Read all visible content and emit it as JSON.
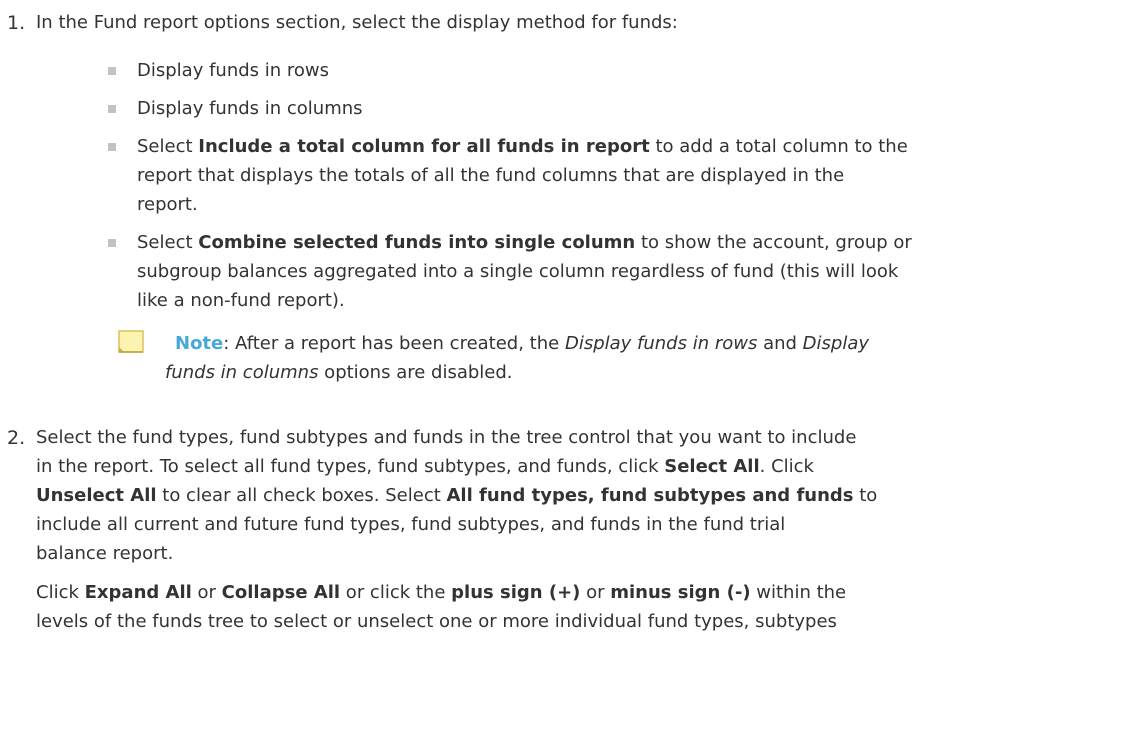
{
  "step1": {
    "number": "1.",
    "intro": "In the Fund report options section, select the display method for funds:",
    "bullets": [
      {
        "text": "Display funds in rows"
      },
      {
        "text": "Display funds in columns"
      },
      {
        "pre": "Select ",
        "bold": "Include a total column for all funds in report",
        "post_l1": " to add a total column to the",
        "line2": "report that displays the totals of all the fund columns that are displayed in the",
        "line3": "report."
      },
      {
        "pre": "Select ",
        "bold": "Combine selected funds into single column",
        "post_l1": " to show the account, group or",
        "line2": "subgroup balances aggregated into a single column regardless of fund (this will look",
        "line3": "like a non-fund report)."
      }
    ],
    "note": {
      "icon": "note-icon",
      "label": "Note",
      "colon": ": After a report has been created, the ",
      "italic1": "Display funds in rows",
      "mid": " and ",
      "italic2_l1": "Display",
      "italic2_l2": "funds in columns",
      "end": " options are disabled."
    }
  },
  "step2": {
    "number": "2.",
    "p1_l1": "Select the fund types, fund subtypes and funds in the tree control that you want to include",
    "p1_l2_a": "in the report. To select all fund types, fund subtypes, and funds, click ",
    "p1_l2_b": "Select All",
    "p1_l2_c": ". Click",
    "p1_l3_a": "Unselect All",
    "p1_l3_b": " to clear all check boxes. Select ",
    "p1_l3_c": "All fund types, fund subtypes and funds",
    "p1_l3_d": " to",
    "p1_l4": "include all current and future fund types, fund subtypes, and funds in the fund trial",
    "p1_l5": "balance report.",
    "p2_l1_a": "Click ",
    "p2_l1_b": "Expand All",
    "p2_l1_c": " or ",
    "p2_l1_d": "Collapse All",
    "p2_l1_e": " or click the ",
    "p2_l1_f": "plus sign (+)",
    "p2_l1_g": " or ",
    "p2_l1_h": "minus sign (-)",
    "p2_l1_i": " within the",
    "p2_l2": "levels of the funds tree to select or unselect one or more individual fund types, subtypes"
  }
}
